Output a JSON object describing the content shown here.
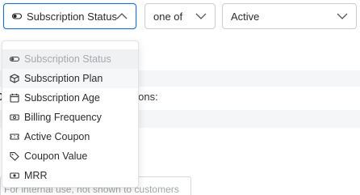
{
  "filter": {
    "field": {
      "value": "Subscription Status",
      "icon": "toggle-icon"
    },
    "operator": {
      "value": "one of"
    },
    "value_select": {
      "value": "Active"
    }
  },
  "background": {
    "partial_label": "ions:",
    "description_placeholder": "For internal use, not shown to customers"
  },
  "menu": {
    "items": [
      {
        "label": "Subscription Status",
        "icon": "toggle-icon",
        "state": "selected"
      },
      {
        "label": "Subscription Plan",
        "icon": "cube-icon",
        "state": "hover"
      },
      {
        "label": "Subscription Age",
        "icon": "calendar-icon",
        "state": ""
      },
      {
        "label": "Billing Frequency",
        "icon": "billing-icon",
        "state": ""
      },
      {
        "label": "Active Coupon",
        "icon": "coupon-icon",
        "state": ""
      },
      {
        "label": "Coupon Value",
        "icon": "tag-icon",
        "state": ""
      },
      {
        "label": "MRR",
        "icon": "money-icon",
        "state": ""
      }
    ]
  },
  "colors": {
    "accent": "#1f6fd6",
    "border": "#c9cdd4",
    "muted": "#a6a9ae"
  }
}
